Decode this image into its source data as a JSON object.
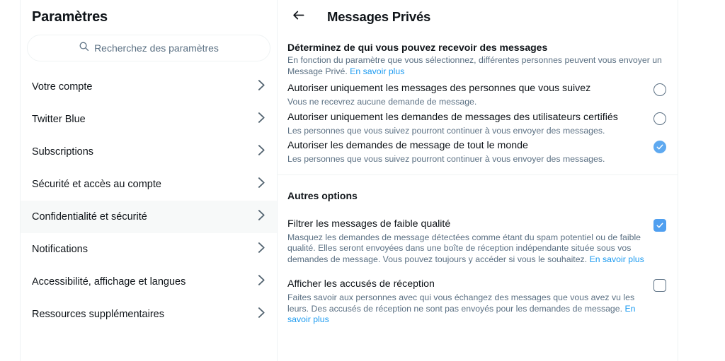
{
  "sidebar": {
    "title": "Paramètres",
    "search": {
      "placeholder": "Recherchez des paramètres",
      "icon": "search-icon",
      "value": ""
    },
    "items": [
      {
        "label": "Votre compte",
        "active": false
      },
      {
        "label": "Twitter Blue",
        "active": false
      },
      {
        "label": "Subscriptions",
        "active": false
      },
      {
        "label": "Sécurité et accès au compte",
        "active": false
      },
      {
        "label": "Confidentialité et sécurité",
        "active": true
      },
      {
        "label": "Notifications",
        "active": false
      },
      {
        "label": "Accessibilité, affichage et langues",
        "active": false
      },
      {
        "label": "Ressources supplémentaires",
        "active": false
      }
    ],
    "chevron_icon": "chevron-right-icon"
  },
  "main": {
    "back_icon": "arrow-left-icon",
    "title": "Messages Privés",
    "sections": [
      {
        "heading": "Déterminez de qui vous pouvez recevoir des messages",
        "description": "En fonction du paramètre que vous sélectionnez, différentes personnes peuvent vous envoyer un Message Privé.",
        "description_link": "En savoir plus",
        "options": [
          {
            "label": "Autoriser uniquement les messages des personnes que vous suivez",
            "sub": "Vous ne recevrez aucune demande de message.",
            "control": "radio",
            "checked": false
          },
          {
            "label": "Autoriser uniquement les demandes de messages des utilisateurs certifiés",
            "sub": "Les personnes que vous suivez pourront continuer à vous envoyer des messages.",
            "control": "radio",
            "checked": false
          },
          {
            "label": "Autoriser les demandes de message de tout le monde",
            "sub": "Les personnes que vous suivez pourront continuer à vous envoyer des messages.",
            "control": "radio",
            "checked": true
          }
        ]
      },
      {
        "heading": "Autres options",
        "options": [
          {
            "label": "Filtrer les messages de faible qualité",
            "sub": "Masquez les demandes de message détectées comme étant du spam potentiel ou de faible qualité. Elles seront envoyées dans une boîte de réception indépendante située sous vos demandes de message. Vous pouvez toujours y accéder si vous le souhaitez.",
            "sub_link": "En savoir plus",
            "control": "checkbox",
            "checked": true
          },
          {
            "label": "Afficher les accusés de réception",
            "sub": "Faites savoir aux personnes avec qui vous échangez des messages que vous avez vu les leurs. Des accusés de réception ne sont pas envoyés pour les demandes de message.",
            "sub_link": "En savoir plus",
            "control": "checkbox",
            "checked": false
          }
        ]
      }
    ]
  },
  "colors": {
    "accent": "#1d9bf0",
    "text_primary": "#0f1419",
    "text_secondary": "#5b7083",
    "border": "#eff3f4",
    "active_row": "#f7f9f9",
    "control_checked": "#4f9ff0"
  }
}
